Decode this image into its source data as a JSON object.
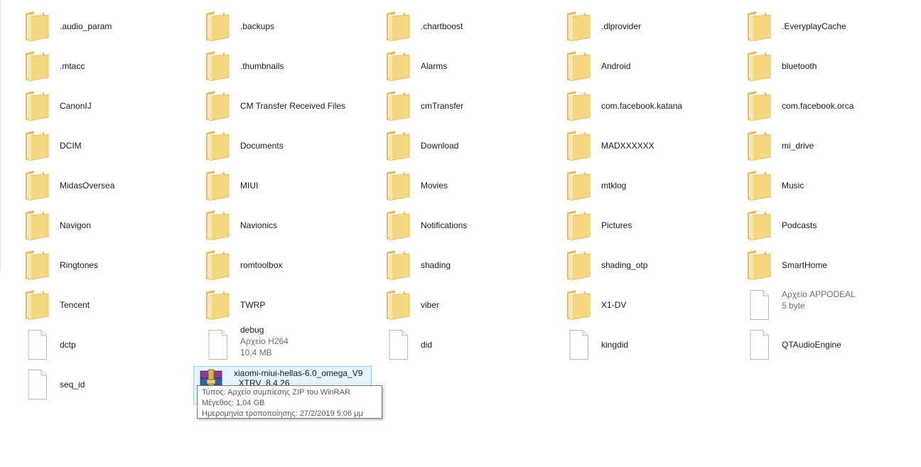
{
  "items": [
    {
      "name": ".audio_param",
      "type": "folder"
    },
    {
      "name": ".backups",
      "type": "folder"
    },
    {
      "name": ".chartboost",
      "type": "folder"
    },
    {
      "name": ".dlprovider",
      "type": "folder"
    },
    {
      "name": ".EveryplayCache",
      "type": "folder"
    },
    {
      "name": ".mtacc",
      "type": "folder"
    },
    {
      "name": ".thumbnails",
      "type": "folder"
    },
    {
      "name": "Alarms",
      "type": "folder"
    },
    {
      "name": "Android",
      "type": "folder"
    },
    {
      "name": "bluetooth",
      "type": "folder"
    },
    {
      "name": "CanonIJ",
      "type": "folder"
    },
    {
      "name": "CM Transfer Received Files",
      "type": "folder"
    },
    {
      "name": "cmTransfer",
      "type": "folder"
    },
    {
      "name": "com.facebook.katana",
      "type": "folder"
    },
    {
      "name": "com.facebook.orca",
      "type": "folder"
    },
    {
      "name": "DCIM",
      "type": "folder"
    },
    {
      "name": "Documents",
      "type": "folder"
    },
    {
      "name": "Download",
      "type": "folder"
    },
    {
      "name": "MADXXXXXX",
      "type": "folder"
    },
    {
      "name": "mi_drive",
      "type": "folder"
    },
    {
      "name": "MidasOversea",
      "type": "folder"
    },
    {
      "name": "MIUI",
      "type": "folder"
    },
    {
      "name": "Movies",
      "type": "folder"
    },
    {
      "name": "mtklog",
      "type": "folder"
    },
    {
      "name": "Music",
      "type": "folder"
    },
    {
      "name": "Navigon",
      "type": "folder"
    },
    {
      "name": "Navionics",
      "type": "folder"
    },
    {
      "name": "Notifications",
      "type": "folder"
    },
    {
      "name": "Pictures",
      "type": "folder"
    },
    {
      "name": "Podcasts",
      "type": "folder"
    },
    {
      "name": "Ringtones",
      "type": "folder"
    },
    {
      "name": "romtoolbox",
      "type": "folder"
    },
    {
      "name": "shading",
      "type": "folder"
    },
    {
      "name": "shading_otp",
      "type": "folder"
    },
    {
      "name": "SmartHome",
      "type": "folder"
    },
    {
      "name": "Tencent",
      "type": "folder"
    },
    {
      "name": "TWRP",
      "type": "folder"
    },
    {
      "name": "viber",
      "type": "folder"
    },
    {
      "name": "X1-DV",
      "type": "folder"
    },
    {
      "name": "Αρχείο APPODEAL",
      "type": "file",
      "meta": [
        "5 byte"
      ],
      "dim": true
    },
    {
      "name": "dctp",
      "type": "file"
    },
    {
      "name": "debug",
      "type": "file",
      "meta": [
        "Αρχείο H264",
        "10,4 MB"
      ]
    },
    {
      "name": "did",
      "type": "file"
    },
    {
      "name": "kingdid",
      "type": "file"
    },
    {
      "name": "QTAudioEngine",
      "type": "file"
    },
    {
      "name": "seq_id",
      "type": "file"
    },
    {
      "name": "xiaomi-miui-hellas-6.0_omega_V9_XTRV_8.4.26",
      "type": "zip",
      "selected": true
    }
  ],
  "tooltip": {
    "type_line": "Τύπος: Αρχείο συμπίεσης ZIP του WinRAR",
    "size_line": "Μέγεθος: 1,04 GB",
    "date_line": "Ημερομηνία τροποποίησης: 27/2/2019 5:06 μμ"
  },
  "colors": {
    "folder_body": "#f3d27a",
    "folder_front": "#fbe59c",
    "selection_bg": "#e5f3ff",
    "selection_border": "#99d1ff",
    "text": "#1a1a1a",
    "meta_text": "#6d6d6d"
  }
}
